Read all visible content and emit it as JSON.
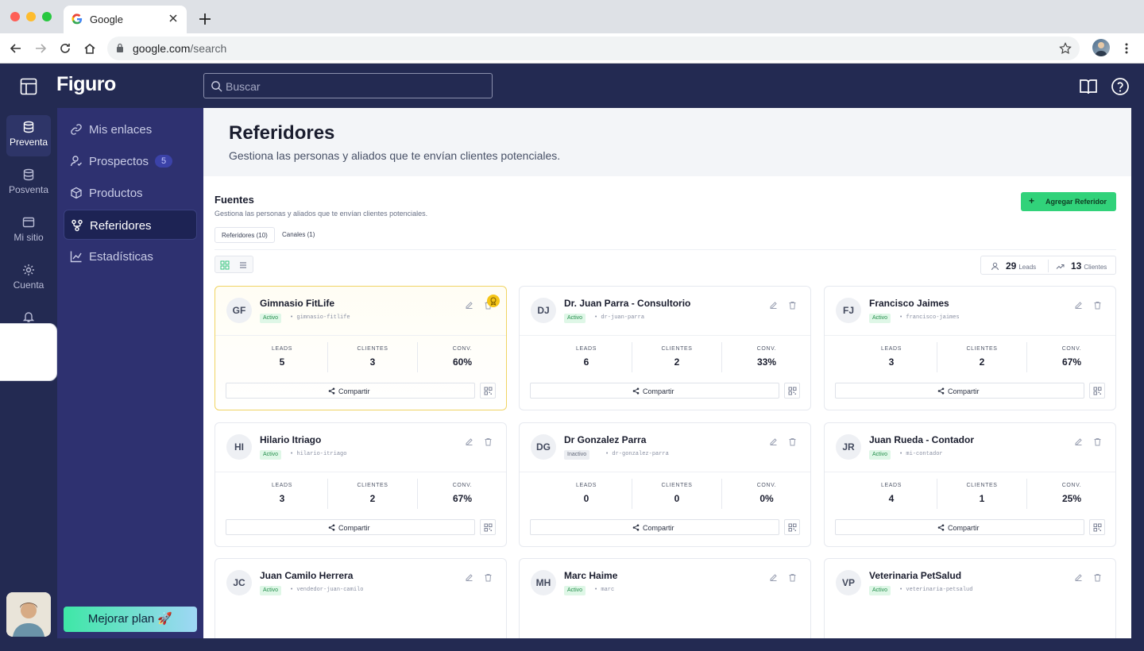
{
  "browser": {
    "tab_title": "Google",
    "url_host": "google.com",
    "url_path": "/search"
  },
  "app": {
    "brand": "Figuro",
    "search_placeholder": "Buscar"
  },
  "rail": [
    {
      "label": "Preventa",
      "icon": "database-icon",
      "active": true
    },
    {
      "label": "Posventa",
      "icon": "database-icon",
      "active": false
    },
    {
      "label": "Mi sitio",
      "icon": "browser-window-icon",
      "active": false
    },
    {
      "label": "Cuenta",
      "icon": "gear-icon",
      "active": false
    }
  ],
  "subnav": [
    {
      "label": "Mis enlaces",
      "icon": "link-icon"
    },
    {
      "label": "Prospectos",
      "icon": "user-icon",
      "badge": "5"
    },
    {
      "label": "Productos",
      "icon": "box-icon"
    },
    {
      "label": "Referidores",
      "icon": "share-network-icon",
      "active": true
    },
    {
      "label": "Estadísticas",
      "icon": "chart-line-icon"
    }
  ],
  "upgrade_label": "Mejorar plan 🚀",
  "page": {
    "title": "Referidores",
    "subtitle": "Gestiona las personas y aliados que te envían clientes potenciales."
  },
  "section": {
    "title": "Fuentes",
    "subtitle": "Gestiona las personas y aliados que te envían clientes potenciales.",
    "add_button": "Agregar Referidor",
    "tabs": [
      "Referidores (10)",
      "Canales (1)"
    ],
    "stats": {
      "leads_value": "29",
      "leads_label": "Leads",
      "clients_value": "13",
      "clients_label": "Clientes"
    }
  },
  "metric_labels": {
    "leads": "LEADS",
    "clients": "CLIENTES",
    "conv": "CONV."
  },
  "share_label": "Compartir",
  "cards": [
    {
      "initials": "GF",
      "name": "Gimnasio FitLife",
      "status": "Activo",
      "slug": "gimnasio-fitlife",
      "leads": "5",
      "clients": "3",
      "conv": "60%",
      "highlight": true
    },
    {
      "initials": "DJ",
      "name": "Dr. Juan Parra - Consultorio",
      "status": "Activo",
      "slug": "dr-juan-parra",
      "leads": "6",
      "clients": "2",
      "conv": "33%"
    },
    {
      "initials": "FJ",
      "name": "Francisco Jaimes",
      "status": "Activo",
      "slug": "francisco-jaimes",
      "leads": "3",
      "clients": "2",
      "conv": "67%"
    },
    {
      "initials": "HI",
      "name": "Hilario Itriago",
      "status": "Activo",
      "slug": "hilario-itriago",
      "leads": "3",
      "clients": "2",
      "conv": "67%"
    },
    {
      "initials": "DG",
      "name": "Dr Gonzalez Parra",
      "status": "Inactivo",
      "slug": "dr-gonzalez-parra",
      "leads": "0",
      "clients": "0",
      "conv": "0%"
    },
    {
      "initials": "JR",
      "name": "Juan Rueda - Contador",
      "status": "Activo",
      "slug": "mi-contador",
      "leads": "4",
      "clients": "1",
      "conv": "25%"
    },
    {
      "initials": "JC",
      "name": "Juan Camilo Herrera",
      "status": "Activo",
      "slug": "vendedor-juan-camilo"
    },
    {
      "initials": "MH",
      "name": "Marc Haime",
      "status": "Activo",
      "slug": "marc"
    },
    {
      "initials": "VP",
      "name": "Veterinaria PetSalud",
      "status": "Activo",
      "slug": "veterinaria-petsalud"
    }
  ],
  "colors": {
    "app_bg": "#232a52",
    "subnav_bg": "#2e3170",
    "accent_green": "#31d27a",
    "highlight": "#f0d463"
  }
}
